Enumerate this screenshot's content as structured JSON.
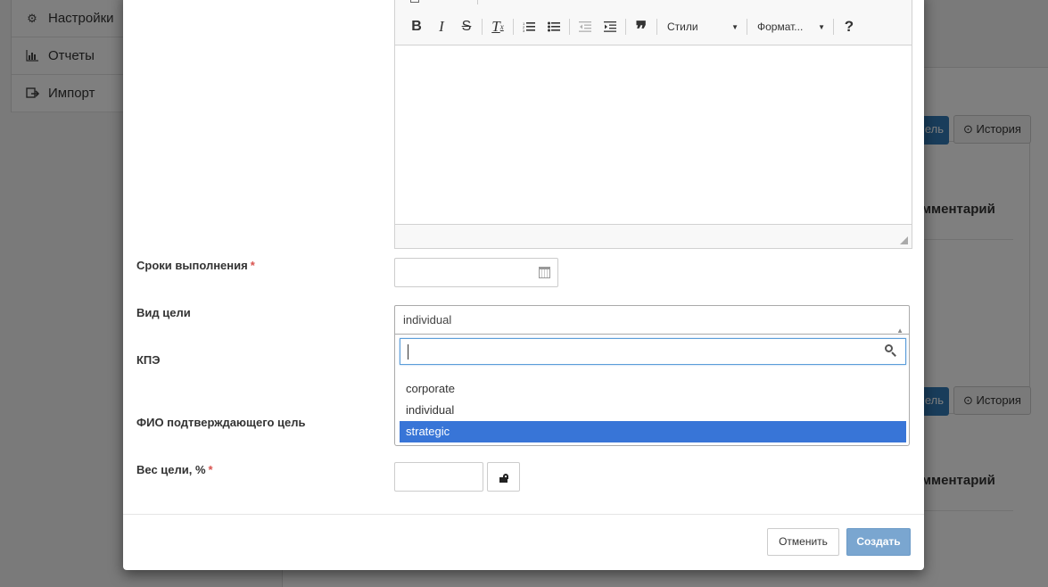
{
  "background": {
    "sidebar_items": [
      {
        "label": "Настройки",
        "icon": "gears-icon"
      },
      {
        "label": "Отчеты",
        "icon": "bar-chart-icon"
      },
      {
        "label": "Импорт",
        "icon": "import-icon"
      }
    ],
    "edit_button_label": "ель",
    "history_label": "История",
    "comment_heading": "омментарий"
  },
  "editor": {
    "toolbar": {
      "styles_label": "Стили",
      "format_label": "Формат..."
    }
  },
  "form": {
    "deadline_label": "Сроки выполнения",
    "goal_type_label": "Вид цели",
    "kpi_label": "КПЭ",
    "approver_label": "ФИО подтверждающего цель",
    "weight_label": "Вес цели, %",
    "required_marker": "*",
    "deadline_value": "",
    "weight_value": ""
  },
  "goal_type_select": {
    "selected": "individual",
    "search_value": "",
    "options": [
      "corporate",
      "individual",
      "strategic"
    ],
    "highlighted": "strategic"
  },
  "footer": {
    "cancel_label": "Отменить",
    "create_label": "Создать"
  },
  "colors": {
    "primary": "#337ab7",
    "highlight": "#3875d7",
    "required": "#d9534f"
  }
}
